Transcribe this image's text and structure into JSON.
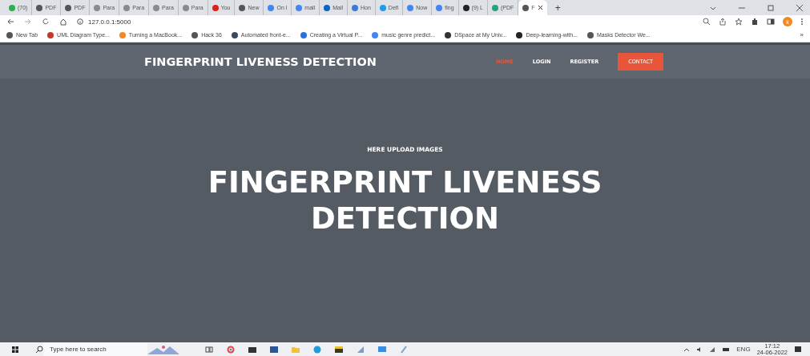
{
  "tabs": [
    {
      "title": "(70)",
      "selected": false,
      "color": "#2fae4e"
    },
    {
      "title": "PDF",
      "selected": false,
      "color": "#555555"
    },
    {
      "title": "PDF",
      "selected": false,
      "color": "#555555"
    },
    {
      "title": "Para",
      "selected": false,
      "color": "#8a8a8a"
    },
    {
      "title": "Para",
      "selected": false,
      "color": "#8a8a8a"
    },
    {
      "title": "Para",
      "selected": false,
      "color": "#8a8a8a"
    },
    {
      "title": "Para",
      "selected": false,
      "color": "#8a8a8a"
    },
    {
      "title": "You",
      "selected": false,
      "color": "#e0201b"
    },
    {
      "title": "New",
      "selected": false,
      "color": "#555555"
    },
    {
      "title": "On l",
      "selected": false,
      "color": "#4285f4"
    },
    {
      "title": "mall",
      "selected": false,
      "color": "#4285f4"
    },
    {
      "title": "Mall",
      "selected": false,
      "color": "#0a66c2"
    },
    {
      "title": "Hon",
      "selected": false,
      "color": "#3d7ad8"
    },
    {
      "title": "Defi",
      "selected": false,
      "color": "#1d9bf0"
    },
    {
      "title": "Now",
      "selected": false,
      "color": "#4285f4"
    },
    {
      "title": "fing",
      "selected": false,
      "color": "#4285f4"
    },
    {
      "title": "(9) L",
      "selected": false,
      "color": "#222222"
    },
    {
      "title": "(PDF",
      "selected": false,
      "color": "#27a37a"
    },
    {
      "title": "F",
      "selected": true,
      "color": "#555555"
    }
  ],
  "new_tab": "+",
  "address": "127.0.0.1:5000",
  "profile": "k",
  "bookmarks": [
    {
      "title": "New Tab",
      "color": "#555555"
    },
    {
      "title": "UML Diagram Type...",
      "color": "#c0392b"
    },
    {
      "title": "Turning a MacBook...",
      "color": "#f08a24"
    },
    {
      "title": "Hack 36",
      "color": "#555555"
    },
    {
      "title": "Automated front-e...",
      "color": "#3b4a5a"
    },
    {
      "title": "Creating a Virtual P...",
      "color": "#2a6fdb"
    },
    {
      "title": "music genre predict...",
      "color": "#4285f4"
    },
    {
      "title": "DSpace at My Univ...",
      "color": "#333333"
    },
    {
      "title": "Deep-learning-with...",
      "color": "#222222"
    },
    {
      "title": "Masks Detector We...",
      "color": "#555555"
    }
  ],
  "bookmarks_more": "»",
  "site": {
    "brand": "FINGERPRINT LIVENESS DETECTION",
    "nav": [
      {
        "label": "HOME",
        "kind": "link",
        "selected": true
      },
      {
        "label": "LOGIN",
        "kind": "link",
        "selected": false
      },
      {
        "label": "REGISTER",
        "kind": "link",
        "selected": false
      },
      {
        "label": "CONTACT",
        "kind": "button",
        "selected": false
      }
    ],
    "hero": {
      "eyebrow": "HERE UPLOAD IMAGES",
      "title": "FINGERPRINT LIVENESS DETECTION"
    }
  },
  "taskbar": {
    "search": {
      "placeholder": "Type here to search"
    },
    "language": "ENG",
    "time": "17:12",
    "date": "24-06-2022"
  }
}
